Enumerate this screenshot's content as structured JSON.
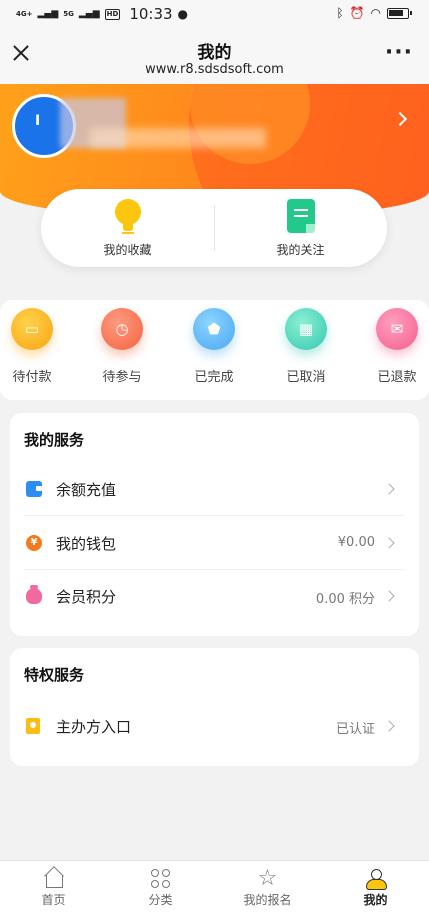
{
  "status_bar": {
    "network1": "4G+",
    "network2": "5G",
    "hd": "HD",
    "time": "10:33",
    "battery_level": 0.85
  },
  "titlebar": {
    "title": "我的",
    "url": "www.r8.sdsdsoft.com"
  },
  "favorites": [
    {
      "label": "我的收藏",
      "icon": "lightbulb-icon"
    },
    {
      "label": "我的关注",
      "icon": "note-icon"
    }
  ],
  "orders": [
    {
      "label": "待付款",
      "icon": "card-icon",
      "color": "#f8a412"
    },
    {
      "label": "待参与",
      "icon": "clock-icon",
      "color": "#f2633f"
    },
    {
      "label": "已完成",
      "icon": "shield-icon",
      "color": "#4aa6f2"
    },
    {
      "label": "已取消",
      "icon": "gift-icon",
      "color": "#34c7b0"
    },
    {
      "label": "已退款",
      "icon": "envelope-icon",
      "color": "#f45d8e"
    }
  ],
  "my_services": {
    "title": "我的服务",
    "rows": [
      {
        "label": "余额充值",
        "value": "",
        "icon": "wallet-icon"
      },
      {
        "label": "我的钱包",
        "value": "¥0.00",
        "icon": "coin-icon"
      },
      {
        "label": "会员积分",
        "value": "0.00 积分",
        "icon": "money-bag-icon"
      }
    ]
  },
  "privilege_services": {
    "title": "特权服务",
    "rows": [
      {
        "label": "主办方入口",
        "value": "已认证",
        "icon": "bookmark-badge-icon"
      }
    ]
  },
  "tabbar": [
    {
      "label": "首页",
      "icon": "home-icon",
      "active": false
    },
    {
      "label": "分类",
      "icon": "grid-icon",
      "active": false
    },
    {
      "label": "我的报名",
      "icon": "star-icon",
      "active": false
    },
    {
      "label": "我的",
      "icon": "profile-icon",
      "active": true
    }
  ],
  "colors": {
    "header_start": "#ffa11a",
    "header_end": "#ff6b1f",
    "accent_yellow": "#fcc60f"
  }
}
